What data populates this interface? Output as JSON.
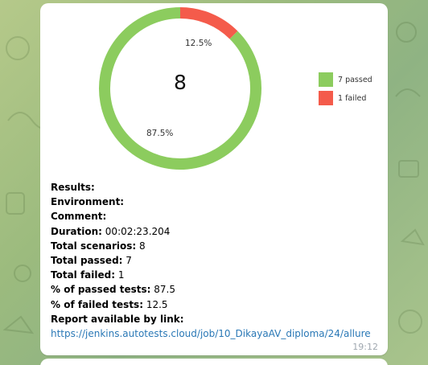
{
  "chart_data": {
    "type": "pie",
    "center_value": "8",
    "categories": [
      "passed",
      "failed"
    ],
    "values": [
      7,
      1
    ],
    "percent_labels": [
      "87.5%",
      "12.5%"
    ],
    "colors": [
      "#8ccc5e",
      "#f45b4b"
    ],
    "legend": [
      "7 passed",
      "1 failed"
    ],
    "legend_position": "right"
  },
  "report": {
    "results_label": "Results:",
    "environment_label": "Environment:",
    "comment_label": "Comment:",
    "duration_label": "Duration:",
    "duration_value": "00:02:23.204",
    "scenarios_label": "Total scenarios:",
    "scenarios_value": "8",
    "passed_label": "Total passed:",
    "passed_value": "7",
    "failed_label": "Total failed:",
    "failed_value": "1",
    "pct_passed_label": "% of passed tests:",
    "pct_passed_value": "87.5",
    "pct_failed_label": "% of failed tests:",
    "pct_failed_value": "12.5",
    "report_link_label": "Report available by link:",
    "report_link": "https://jenkins.autotests.cloud/job/10_DikayaAV_diploma/24/allure"
  },
  "message": {
    "time": "19:12"
  }
}
